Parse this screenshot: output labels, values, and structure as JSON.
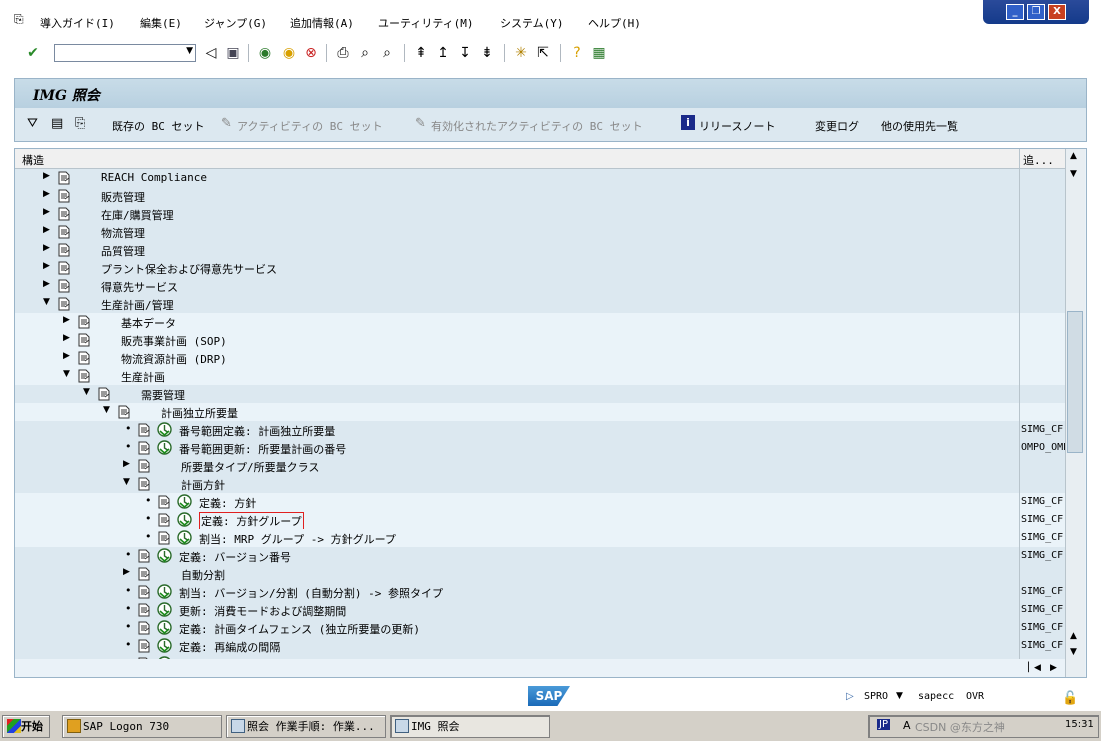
{
  "menubar": {
    "items": [
      "導入ガイド(I)",
      "編集(E)",
      "ジャンプ(G)",
      "追加情報(A)",
      "ユーティリティ(M)",
      "システム(Y)",
      "ヘルプ(H)"
    ]
  },
  "window_controls": {
    "minimize": "_",
    "restore": "❐",
    "close": "X"
  },
  "toolbar": {
    "command_field_value": ""
  },
  "title": {
    "text": "IMG 照会"
  },
  "app_toolbar": {
    "existing_bc_set": "既存の BC セット",
    "activity_bc_set": "アクティビティの BC セット",
    "activated_activity_bc_set": "有効化されたアクティビティの BC セット",
    "release_notes": "リリースノート",
    "change_log": "変更ログ",
    "where_used": "他の使用先一覧"
  },
  "tree": {
    "header_structure": "構造",
    "header_col2": "追...",
    "rows": [
      {
        "text": "REACH Compliance",
        "col2": ""
      },
      {
        "text": "販売管理",
        "col2": ""
      },
      {
        "text": "在庫/購買管理",
        "col2": ""
      },
      {
        "text": "物流管理",
        "col2": ""
      },
      {
        "text": "品質管理",
        "col2": ""
      },
      {
        "text": "プラント保全および得意先サービス",
        "col2": ""
      },
      {
        "text": "得意先サービス",
        "col2": ""
      },
      {
        "text": "生産計画/管理",
        "col2": ""
      },
      {
        "text": "基本データ",
        "col2": ""
      },
      {
        "text": "販売事業計画 (SOP)",
        "col2": ""
      },
      {
        "text": "物流資源計画 (DRP)",
        "col2": ""
      },
      {
        "text": "生産計画",
        "col2": ""
      },
      {
        "text": "需要管理",
        "col2": ""
      },
      {
        "text": "計画独立所要量",
        "col2": ""
      },
      {
        "text": "番号範囲定義: 計画独立所要量",
        "col2": "SIMG_CF"
      },
      {
        "text": "番号範囲更新: 所要量計画の番号",
        "col2": "OMPO_OMP"
      },
      {
        "text": "所要量タイプ/所要量クラス",
        "col2": ""
      },
      {
        "text": "計画方針",
        "col2": ""
      },
      {
        "text": "定義: 方針",
        "col2": "SIMG_CF"
      },
      {
        "text": "定義: 方針グループ",
        "col2": "SIMG_CF"
      },
      {
        "text": "割当: MRP グループ -> 方針グループ",
        "col2": "SIMG_CF"
      },
      {
        "text": "定義: バージョン番号",
        "col2": "SIMG_CF"
      },
      {
        "text": "自動分割",
        "col2": ""
      },
      {
        "text": "割当: バージョン/分割 (自動分割) -> 参照タイプ",
        "col2": "SIMG_CF"
      },
      {
        "text": "更新: 消費モードおよび調整期間",
        "col2": "SIMG_CF"
      },
      {
        "text": "定義: 計画タイムフェンス (独立所要量の更新)",
        "col2": "SIMG_CF"
      },
      {
        "text": "定義: 再編成の間隔",
        "col2": "SIMG_CF"
      },
      {
        "text": "計画独立所要量の再編成",
        "col2": "SIMG_CF"
      }
    ]
  },
  "statusbar": {
    "sap_logo": "SAP",
    "transaction": "SPRO",
    "server": "sapecc",
    "mode": "OVR"
  },
  "taskbar": {
    "start": "开始",
    "buttons": [
      "SAP Logon 730",
      "照会 作業手順: 作業...",
      "IMG 照会"
    ],
    "tray_lang": "JP",
    "watermark": "CSDN @东方之神",
    "clock": "15:31"
  }
}
